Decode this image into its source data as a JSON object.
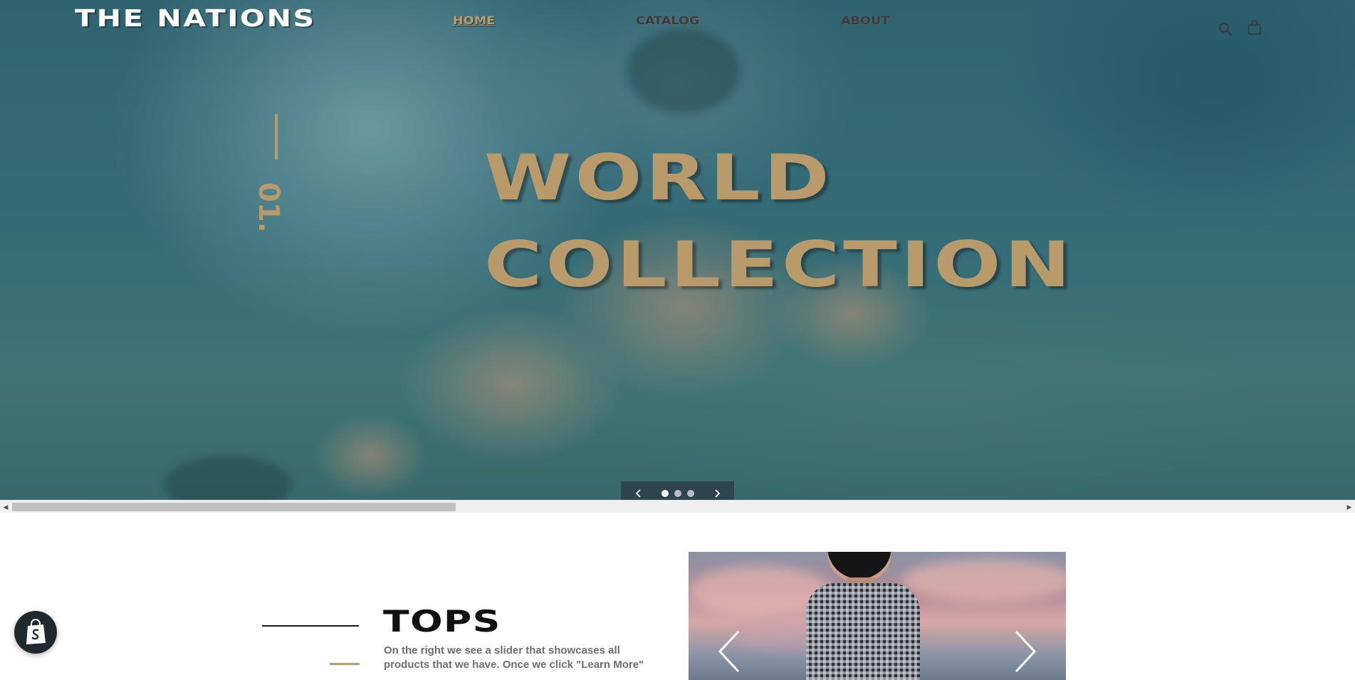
{
  "header": {
    "logo": "THE NATIONS",
    "nav": [
      {
        "label": "HOME",
        "active": true
      },
      {
        "label": "CATALOG",
        "active": false
      },
      {
        "label": "ABOUT",
        "active": false
      }
    ],
    "icons": [
      "search-icon",
      "cart-icon"
    ]
  },
  "hero": {
    "slide_number": "01.",
    "title_line1": "WORLD",
    "title_line2": "COLLECTION",
    "slider": {
      "slides": 3,
      "active_slide": 1
    }
  },
  "tops": {
    "title": "TOPS",
    "description": "On the right we see a slider that showcases all products that we have. Once we click \"Learn More\""
  },
  "colors": {
    "accent": "#b89a6b",
    "logo": "#ffffff",
    "dark": "#111111",
    "description": "#6e6e6e"
  }
}
